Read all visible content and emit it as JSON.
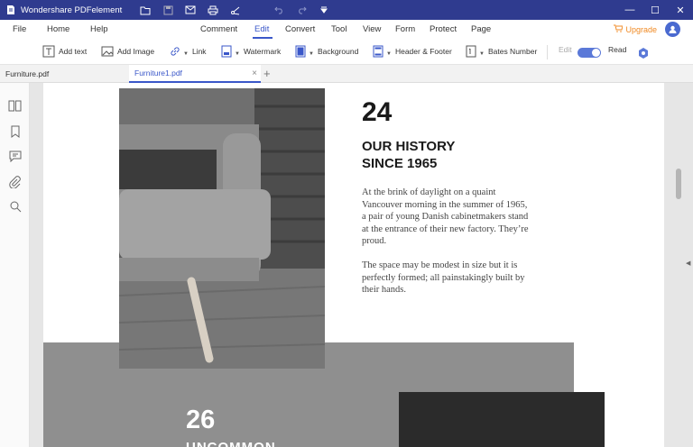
{
  "app": {
    "title": "Wondershare PDFelement",
    "brand_color": "#2f3b8f",
    "accent_color": "#3a57c9"
  },
  "titlebar_icons": [
    "folder-icon",
    "save-icon",
    "mail-icon",
    "print-icon",
    "share-icon",
    "undo-icon",
    "redo-icon",
    "dropdown-icon"
  ],
  "window_controls": {
    "minimize": "—",
    "maximize": "☐",
    "close": "✕"
  },
  "menu": {
    "items": [
      "File",
      "Home",
      "Help",
      "Comment",
      "Edit",
      "Convert",
      "Tool",
      "View",
      "Form",
      "Protect",
      "Page"
    ],
    "active": "Edit",
    "upgrade_label": "Upgrade"
  },
  "toolbar": {
    "add_text": "Add text",
    "add_image": "Add Image",
    "link": "Link",
    "watermark": "Watermark",
    "background": "Background",
    "header_footer": "Header & Footer",
    "bates_number": "Bates Number",
    "edit_label": "Edit",
    "read_label": "Read"
  },
  "tabs": [
    {
      "label": "Furniture.pdf",
      "active": false
    },
    {
      "label": "Furniture1.pdf",
      "active": true
    }
  ],
  "sidebar_icons": [
    "thumbnails-icon",
    "bookmark-icon",
    "comment-icon",
    "attachment-icon",
    "search-icon"
  ],
  "document": {
    "page_number_1": "24",
    "heading_line1": "OUR HISTORY",
    "heading_line2": "SINCE 1965",
    "paragraph1": "At the brink of daylight on a quaint Vancouver morning in the summer of 1965, a pair of young Danish cabinetmakers stand at the entrance of their new factory. They’re proud.",
    "paragraph2": "The space may be modest in size but it is perfectly formed; all painstakingly built by their hands.",
    "page_number_2": "26",
    "heading_2_partial": "UNCOMMON"
  }
}
